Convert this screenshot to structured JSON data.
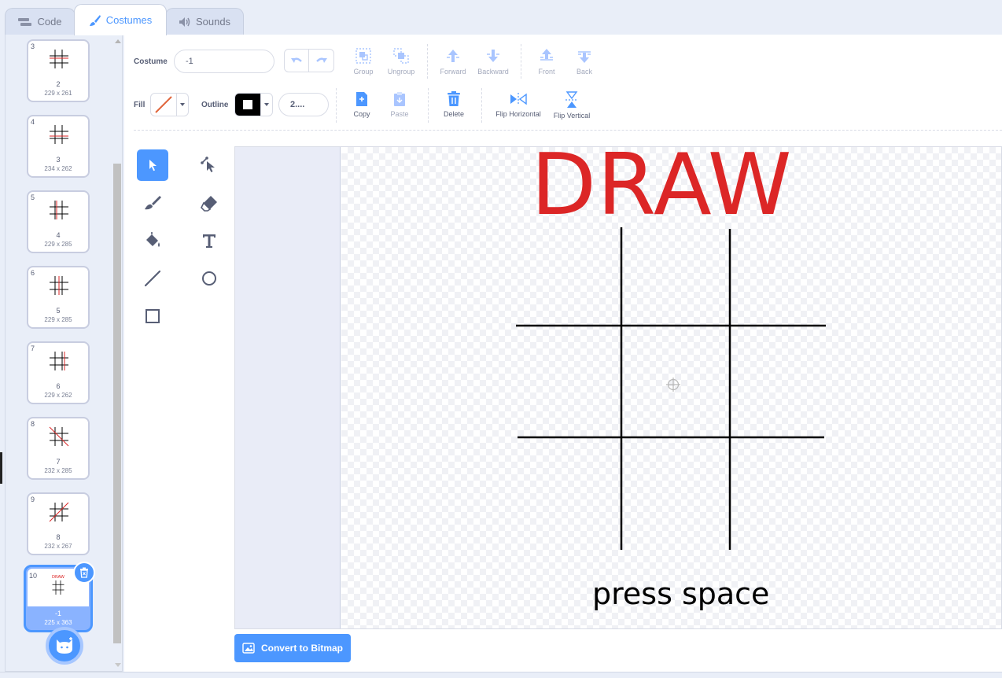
{
  "tabs": [
    {
      "label": "Code",
      "icon": "code-blocks-icon"
    },
    {
      "label": "Costumes",
      "icon": "paintbrush-icon"
    },
    {
      "label": "Sounds",
      "icon": "speaker-icon"
    }
  ],
  "costumes": [
    {
      "number": "3",
      "name": "2",
      "size": "229 x 261"
    },
    {
      "number": "4",
      "name": "3",
      "size": "234 x 262"
    },
    {
      "number": "5",
      "name": "4",
      "size": "229 x 285"
    },
    {
      "number": "6",
      "name": "5",
      "size": "229 x 285"
    },
    {
      "number": "7",
      "name": "6",
      "size": "229 x 262"
    },
    {
      "number": "8",
      "name": "7",
      "size": "232 x 285"
    },
    {
      "number": "9",
      "name": "8",
      "size": "232 x 267"
    },
    {
      "number": "10",
      "name": "-1",
      "size": "225 x 363",
      "thumb_text": "DRAW"
    }
  ],
  "toolbar": {
    "costume_label": "Costume",
    "costume_name": "-1",
    "group": "Group",
    "ungroup": "Ungroup",
    "forward": "Forward",
    "backward": "Backward",
    "front": "Front",
    "back": "Back",
    "fill_label": "Fill",
    "outline_label": "Outline",
    "outline_width": "2....",
    "copy": "Copy",
    "paste": "Paste",
    "delete": "Delete",
    "flip_horizontal": "Flip Horizontal",
    "flip_vertical": "Flip Vertical"
  },
  "canvas": {
    "title_text": "DRAW",
    "footer_text": "press space"
  },
  "convert_button": "Convert to Bitmap",
  "colors": {
    "accent": "#4c97ff",
    "draw_red": "#dc2626",
    "fill_line": "#e0643a",
    "outline": "#000000"
  }
}
